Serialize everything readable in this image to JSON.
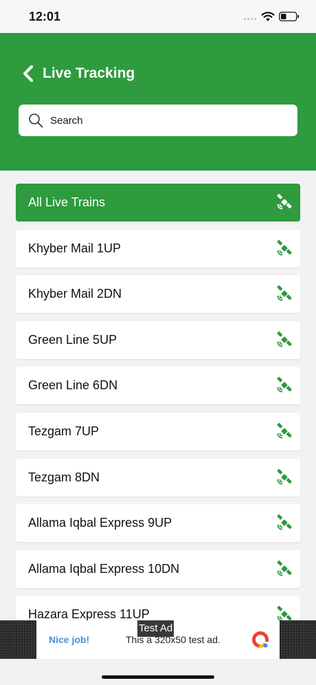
{
  "status_bar": {
    "time": "12:01"
  },
  "header": {
    "title": "Live Tracking",
    "back_icon": "chevron-left-icon"
  },
  "search": {
    "placeholder": "Search",
    "value": ""
  },
  "trains": [
    {
      "label": "All Live Trains",
      "active": true
    },
    {
      "label": "Khyber Mail 1UP",
      "active": false
    },
    {
      "label": "Khyber Mail 2DN",
      "active": false
    },
    {
      "label": "Green Line 5UP",
      "active": false
    },
    {
      "label": "Green Line 6DN",
      "active": false
    },
    {
      "label": "Tezgam 7UP",
      "active": false
    },
    {
      "label": "Tezgam 8DN",
      "active": false
    },
    {
      "label": "Allama Iqbal Express 9UP",
      "active": false
    },
    {
      "label": "Allama Iqbal Express 10DN",
      "active": false
    },
    {
      "label": "Hazara Express 11UP",
      "active": false
    }
  ],
  "ad": {
    "tag": "Test Ad",
    "headline": "Nice job!",
    "text": "This a 320x50 test ad."
  },
  "colors": {
    "accent": "#2d9b3e",
    "background": "#f2f2f2",
    "ad_link": "#4a8fd6"
  }
}
